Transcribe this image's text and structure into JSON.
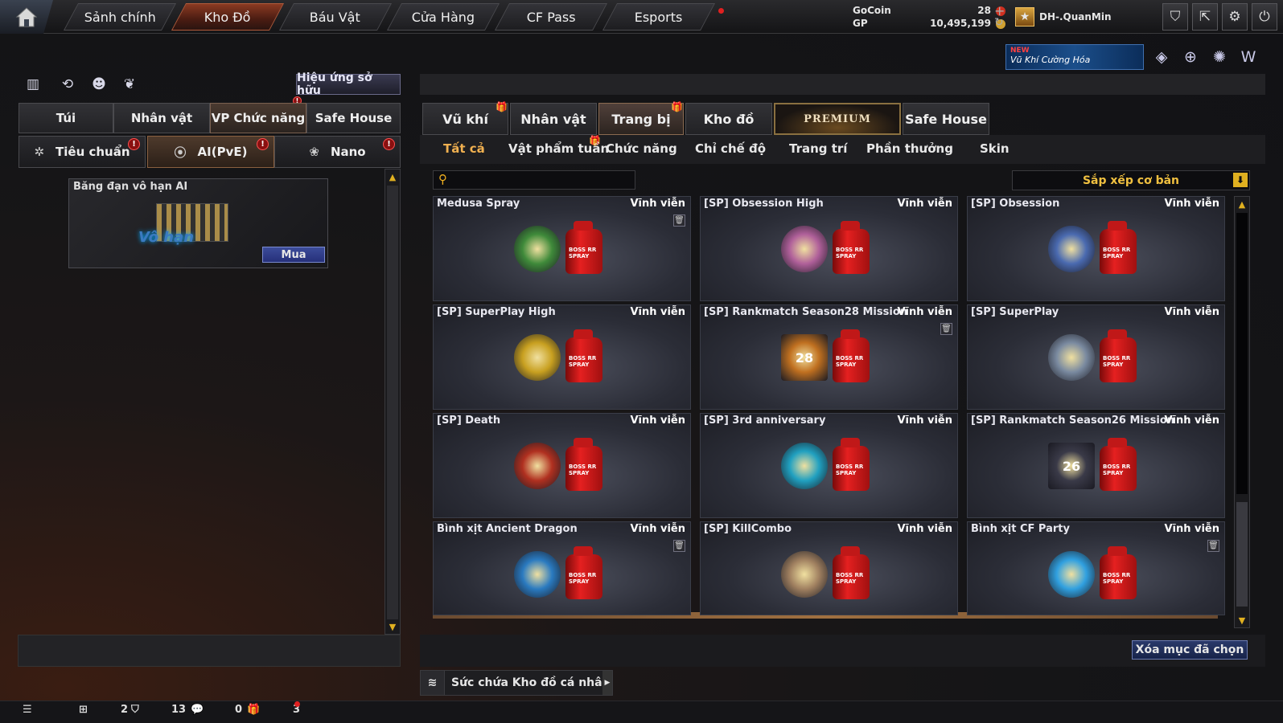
{
  "nav": {
    "tabs": [
      "Sảnh chính",
      "Kho Đồ",
      "Báu Vật",
      "Cửa Hàng",
      "CF Pass",
      "Esports"
    ],
    "active_tab": "Kho Đồ"
  },
  "currency": {
    "gocoin_label": "GoCoin",
    "gocoin_value": "28",
    "gp_label": "GP",
    "gp_value": "10,495,199"
  },
  "user": {
    "name": "DH-.QuanMin"
  },
  "promo": {
    "badge": "NEW",
    "text": "Vũ Khí Cường Hóa"
  },
  "left": {
    "effects_button": "Hiệu ứng sở hữu",
    "tabs": [
      "Túi",
      "Nhân vật",
      "VP Chức năng",
      "Safe House"
    ],
    "active_tab": "VP Chức năng",
    "subtabs": [
      "Tiêu chuẩn",
      "AI(PvE)",
      "Nano"
    ],
    "active_subtab": "AI(PvE)",
    "item": {
      "name": "Băng đạn vô hạn AI",
      "image_text": "Vô hạn",
      "buy_label": "Mua"
    }
  },
  "right": {
    "tabs": [
      "Vũ khí",
      "Nhân vật",
      "Trang bị",
      "Kho đồ",
      "PREMIUM",
      "Safe House"
    ],
    "active_tab": "Trang bị",
    "subtabs": [
      "Tất cả",
      "Vật phẩm tuần",
      "Chức năng",
      "Chỉ chế độ",
      "Trang trí",
      "Phần thưởng",
      "Skin"
    ],
    "active_subtab": "Tất cả",
    "search_placeholder": "",
    "sort_label": "Sắp xếp cơ bản",
    "spray_label": "BOSS RR SPRAY",
    "items": [
      {
        "name": "Medusa Spray",
        "period": "Vĩnh viễn",
        "trash": true,
        "emblem_color": "#3f8a3a"
      },
      {
        "name": "[SP] Obsession High",
        "period": "Vĩnh viễn",
        "trash": false,
        "emblem_color": "#b0609a"
      },
      {
        "name": "[SP] Obsession",
        "period": "Vĩnh viễn",
        "trash": false,
        "emblem_color": "#4a6ab0"
      },
      {
        "name": "[SP] SuperPlay High",
        "period": "Vĩnh viễn",
        "trash": false,
        "emblem_color": "#c8a020"
      },
      {
        "name": "[SP] Rankmatch Season28 Mission",
        "period": "Vĩnh viễn",
        "trash": true,
        "emblem_color": "#c07020",
        "emblem_text": "28"
      },
      {
        "name": "[SP] SuperPlay",
        "period": "Vĩnh viễn",
        "trash": false,
        "emblem_color": "#7a8aa0"
      },
      {
        "name": "[SP] Death",
        "period": "Vĩnh viễn",
        "trash": false,
        "emblem_color": "#b03020"
      },
      {
        "name": "[SP] 3rd anniversary",
        "period": "Vĩnh viễn",
        "trash": false,
        "emblem_color": "#20a0c0"
      },
      {
        "name": "[SP] Rankmatch Season26 Mission",
        "period": "Vĩnh viễn",
        "trash": false,
        "emblem_color": "#3a3a48",
        "emblem_text": "26"
      },
      {
        "name": "Bình xịt Ancient Dragon",
        "period": "Vĩnh viễn",
        "trash": true,
        "emblem_color": "#2a7ac0"
      },
      {
        "name": "[SP] KillCombo",
        "period": "Vĩnh viễn",
        "trash": false,
        "emblem_color": "#a08060"
      },
      {
        "name": "Bình xịt CF Party",
        "period": "Vĩnh viễn",
        "trash": true,
        "emblem_color": "#30a0e0"
      }
    ],
    "delete_button": "Xóa mục đã chọn",
    "capacity_label": "Sức chứa Kho đồ cá nhân"
  },
  "bottom": {
    "friends": "2",
    "clan": "13",
    "chat": "0",
    "gifts": "3"
  }
}
